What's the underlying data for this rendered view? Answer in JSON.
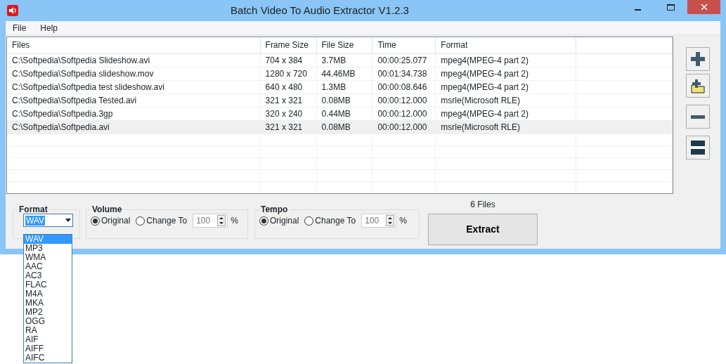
{
  "window": {
    "title": "Batch Video To Audio Extractor V1.2.3"
  },
  "menu": [
    "File",
    "Help"
  ],
  "table": {
    "columns": [
      "Files",
      "Frame Size",
      "File Size",
      "Time",
      "Format"
    ],
    "rows": [
      {
        "cells": [
          "C:\\Softpedia\\Softpedia Slideshow.avi",
          "704 x 384",
          "3.7MB",
          "00:00:25.077",
          "mpeg4(MPEG-4 part 2)"
        ],
        "selected": false
      },
      {
        "cells": [
          "C:\\Softpedia\\Softpedia slideshow.mov",
          "1280 x 720",
          "44.46MB",
          "00:01:34.738",
          "mpeg4(MPEG-4 part 2)"
        ],
        "selected": false
      },
      {
        "cells": [
          "C:\\Softpedia\\Softpedia test slideshow.avi",
          "640 x 480",
          "1.3MB",
          "00:00:08.646",
          "mpeg4(MPEG-4 part 2)"
        ],
        "selected": false
      },
      {
        "cells": [
          "C:\\Softpedia\\Softpedia Tested.avi",
          "321 x 321",
          "0.08MB",
          "00:00:12.000",
          "msrle(Microsoft RLE)"
        ],
        "selected": false
      },
      {
        "cells": [
          "C:\\Softpedia\\Softpedia.3gp",
          "320 x 240",
          "0.44MB",
          "00:00:12.000",
          "mpeg4(MPEG-4 part 2)"
        ],
        "selected": false
      },
      {
        "cells": [
          "C:\\Softpedia\\Softpedia.avi",
          "321 x 321",
          "0.08MB",
          "00:00:12.000",
          "msrle(Microsoft RLE)"
        ],
        "selected": true
      }
    ]
  },
  "tools": [
    {
      "kind": "add"
    },
    {
      "kind": "add-folder"
    },
    {
      "kind": "remove"
    },
    {
      "kind": "clear"
    }
  ],
  "file_count": "6 Files",
  "format": {
    "label": "Format",
    "value": "WAV",
    "options": [
      {
        "label": "WAV",
        "selected": true
      },
      {
        "label": "MP3",
        "selected": false
      },
      {
        "label": "WMA",
        "selected": false
      },
      {
        "label": "AAC",
        "selected": false
      },
      {
        "label": "AC3",
        "selected": false
      },
      {
        "label": "FLAC",
        "selected": false
      },
      {
        "label": "M4A",
        "selected": false
      },
      {
        "label": "MKA",
        "selected": false
      },
      {
        "label": "MP2",
        "selected": false
      },
      {
        "label": "OGG",
        "selected": false
      },
      {
        "label": "RA",
        "selected": false
      },
      {
        "label": "AIF",
        "selected": false
      },
      {
        "label": "AIFF",
        "selected": false
      },
      {
        "label": "AIFC",
        "selected": false
      }
    ]
  },
  "volume": {
    "label": "Volume",
    "options": [
      {
        "label": "Original",
        "selected": true
      },
      {
        "label": "Change To",
        "selected": false
      }
    ],
    "value": "100",
    "unit": "%"
  },
  "tempo": {
    "label": "Tempo",
    "options": [
      {
        "label": "Original",
        "selected": true
      },
      {
        "label": "Change To",
        "selected": false
      }
    ],
    "value": "100",
    "unit": "%"
  },
  "extract": "Extract"
}
